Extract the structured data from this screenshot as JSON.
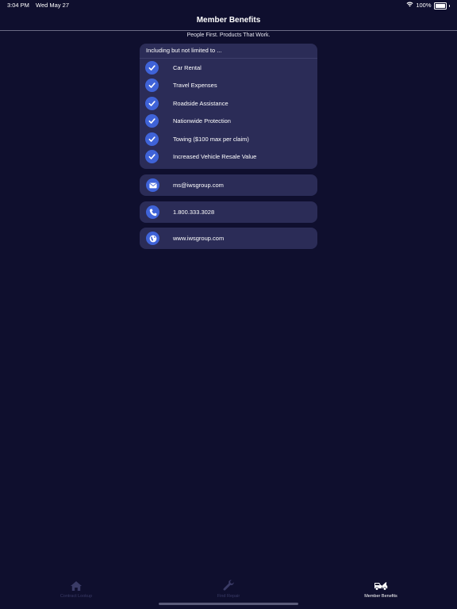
{
  "status_bar": {
    "time": "3:04 PM",
    "date": "Wed May 27",
    "battery": "100%",
    "battery_level": 1.0
  },
  "nav": {
    "title": "Member Benefits"
  },
  "tagline": "People First. Products That Work.",
  "benefits": {
    "header": "Including but not limited to ...",
    "items": [
      {
        "label": "Car Rental",
        "icon": "check-icon"
      },
      {
        "label": "Travel Expenses",
        "icon": "check-icon"
      },
      {
        "label": "Roadside Assistance",
        "icon": "check-icon"
      },
      {
        "label": "Nationwide Protection",
        "icon": "check-icon"
      },
      {
        "label": "Towing ($100 max per claim)",
        "icon": "check-icon"
      },
      {
        "label": "Increased Vehicle Resale Value",
        "icon": "check-icon"
      }
    ]
  },
  "contacts": {
    "email": {
      "label": "ms@iwsgroup.com",
      "icon": "envelope-icon"
    },
    "phone": {
      "label": "1.800.333.3028",
      "icon": "phone-icon"
    },
    "website": {
      "label": "www.iwsgroup.com",
      "icon": "globe-icon"
    }
  },
  "tabs": [
    {
      "label": "Contract Lookup",
      "icon": "home-icon",
      "active": false
    },
    {
      "label": "Find Repair",
      "icon": "wrench-icon",
      "active": false
    },
    {
      "label": "Member Benefits",
      "icon": "tow-truck-icon",
      "active": true
    }
  ],
  "colors": {
    "background": "#0f0f2e",
    "card": "#2b2c57",
    "accent": "#3f63d8",
    "tab_inactive": "#3a3b66",
    "tab_active": "#ffffff"
  }
}
